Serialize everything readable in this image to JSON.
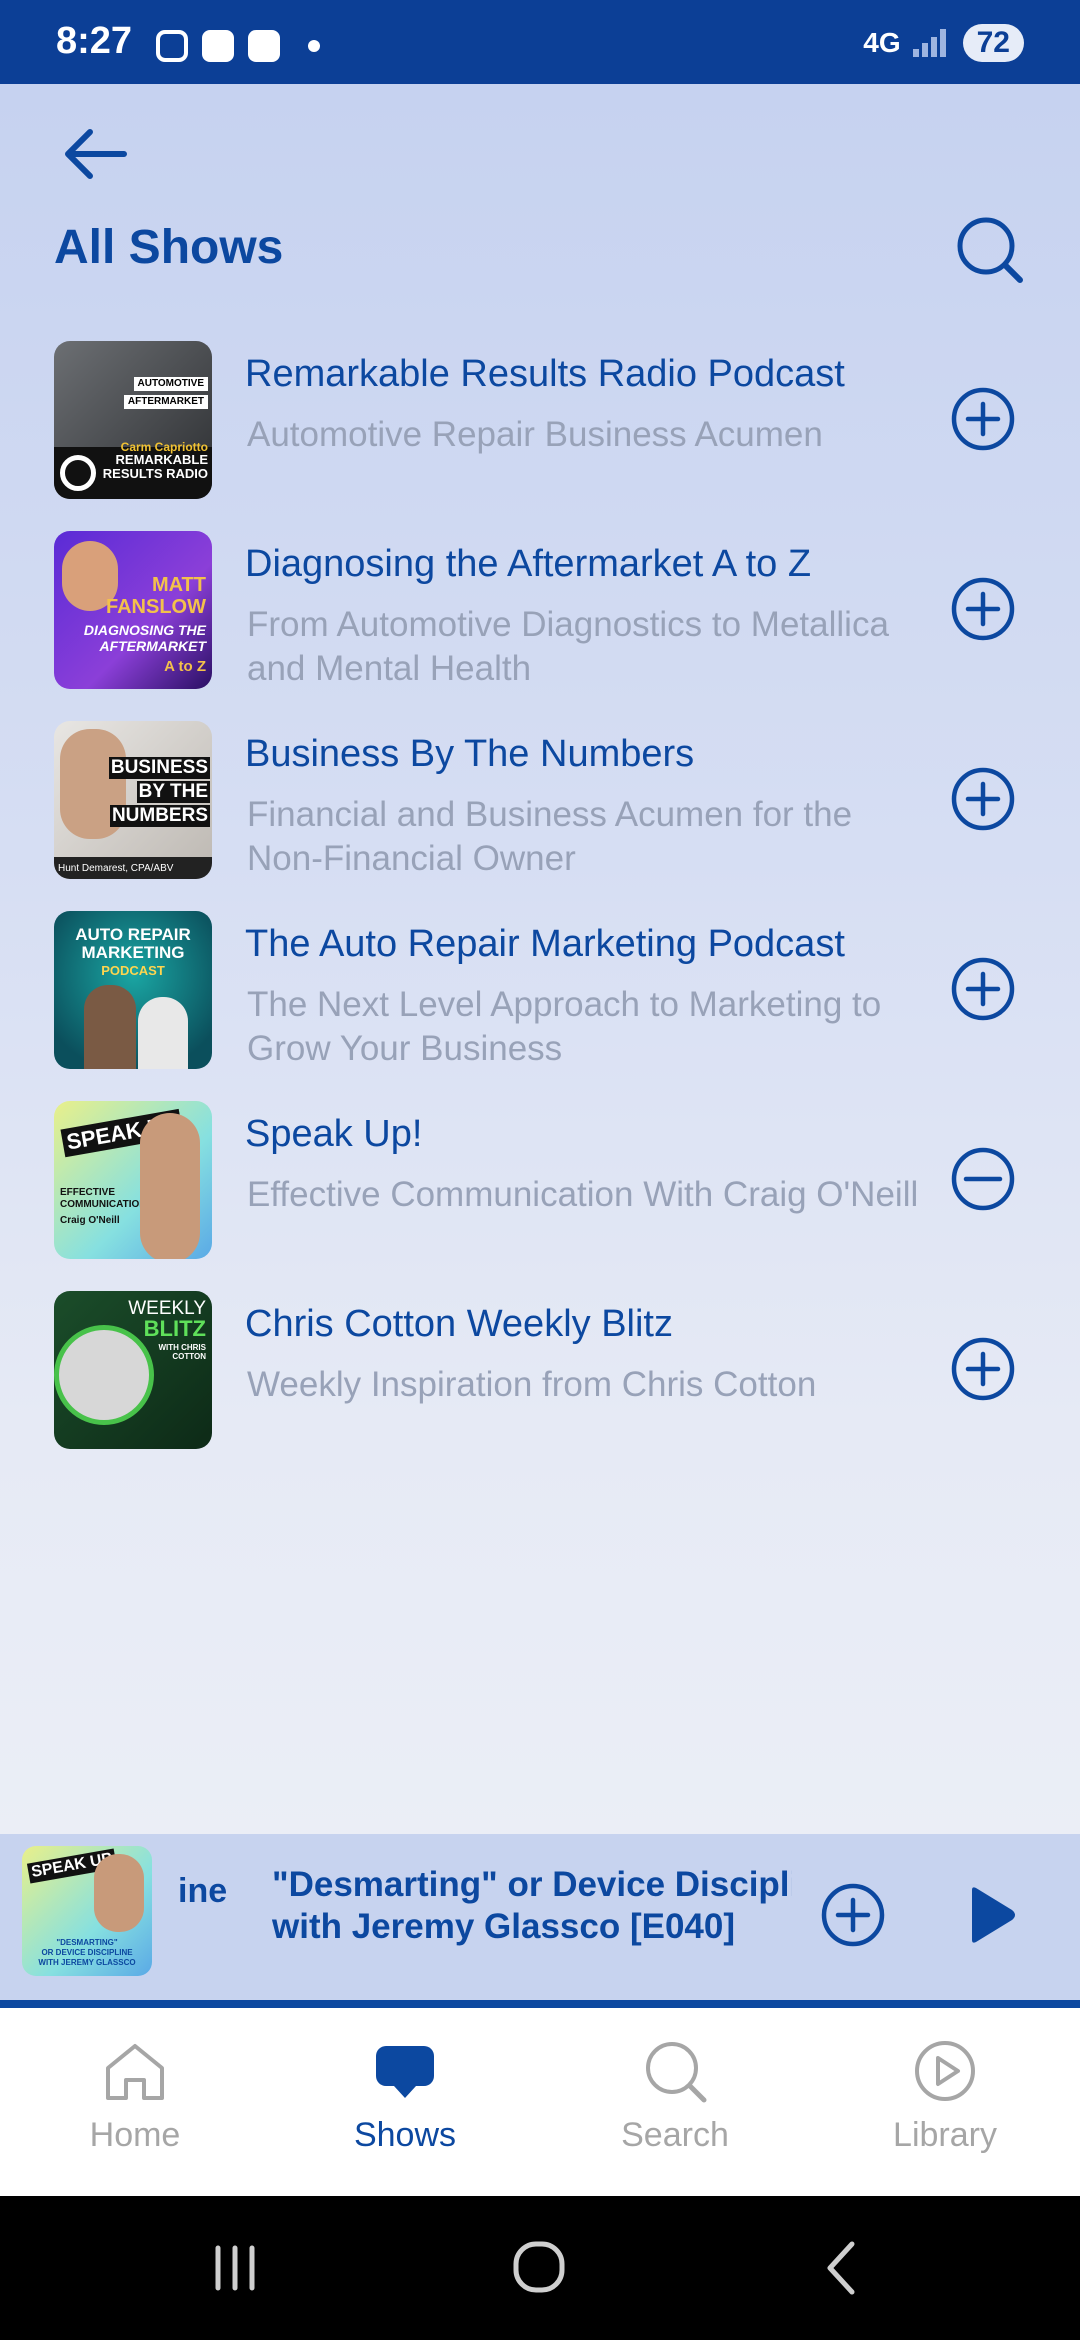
{
  "status_bar": {
    "time": "8:27",
    "network": "4G",
    "battery": "72"
  },
  "header": {
    "title": "All Shows"
  },
  "shows": [
    {
      "title": "Remarkable Results Radio Podcast",
      "subtitle": "Automotive Repair Business Acumen",
      "subscribed": false,
      "art": {
        "lines": [
          "AUTOMOTIVE",
          "AFTERMARKET",
          "Carm Capriotto",
          "REMARKABLE",
          "RESULTS RADIO"
        ]
      }
    },
    {
      "title": "Diagnosing the Aftermarket A to Z",
      "subtitle": "From Automotive Diagnostics to Metallica and Mental Health",
      "subscribed": false,
      "art": {
        "lines": [
          "MATT",
          "FANSLOW",
          "DIAGNOSING THE",
          "AFTERMARKET",
          "A to Z"
        ]
      }
    },
    {
      "title": "Business By The Numbers",
      "subtitle": "Financial and Business Acumen for the Non-Financial Owner",
      "subscribed": false,
      "art": {
        "lines": [
          "BUSINESS",
          "BY THE",
          "NUMBERS",
          "Hunt Demarest, CPA/ABV"
        ]
      }
    },
    {
      "title": "The Auto Repair Marketing Podcast",
      "subtitle": "The Next Level Approach to Marketing to Grow Your Business",
      "subscribed": false,
      "art": {
        "lines": [
          "AUTO REPAIR",
          "MARKETING",
          "PODCAST"
        ]
      }
    },
    {
      "title": "Speak Up!",
      "subtitle": "Effective Communication With Craig O'Neill",
      "subscribed": true,
      "art": {
        "lines": [
          "SPEAK UP",
          "EFFECTIVE",
          "COMMUNICATION",
          "Craig O'Neill"
        ]
      }
    },
    {
      "title": "Chris Cotton Weekly Blitz",
      "subtitle": "Weekly Inspiration from Chris Cotton",
      "subscribed": false,
      "art": {
        "lines": [
          "WEEKLY",
          "BLITZ",
          "WITH CHRIS",
          "COTTON"
        ]
      }
    }
  ],
  "mini_player": {
    "show_fragment": "ine",
    "episode_title": "\"Desmarting\" or Device Discipli with Jeremy Glassco [E040]",
    "episode_line1": "\"Desmarting\" or Device Discipli",
    "episode_line2": "with Jeremy Glassco [E040]",
    "art_lines": [
      "SPEAK UP",
      "\"DESMARTING\"",
      "OR DEVICE DISCIPLINE",
      "WITH JEREMY GLASSCO"
    ]
  },
  "nav": [
    {
      "label": "Home",
      "active": false
    },
    {
      "label": "Shows",
      "active": true
    },
    {
      "label": "Search",
      "active": false
    },
    {
      "label": "Library",
      "active": false
    }
  ],
  "colors": {
    "primary": "#0c48a0",
    "status_bar": "#0c3f96",
    "inactive": "#a6a6a6",
    "subtitle": "#98a2b8"
  }
}
